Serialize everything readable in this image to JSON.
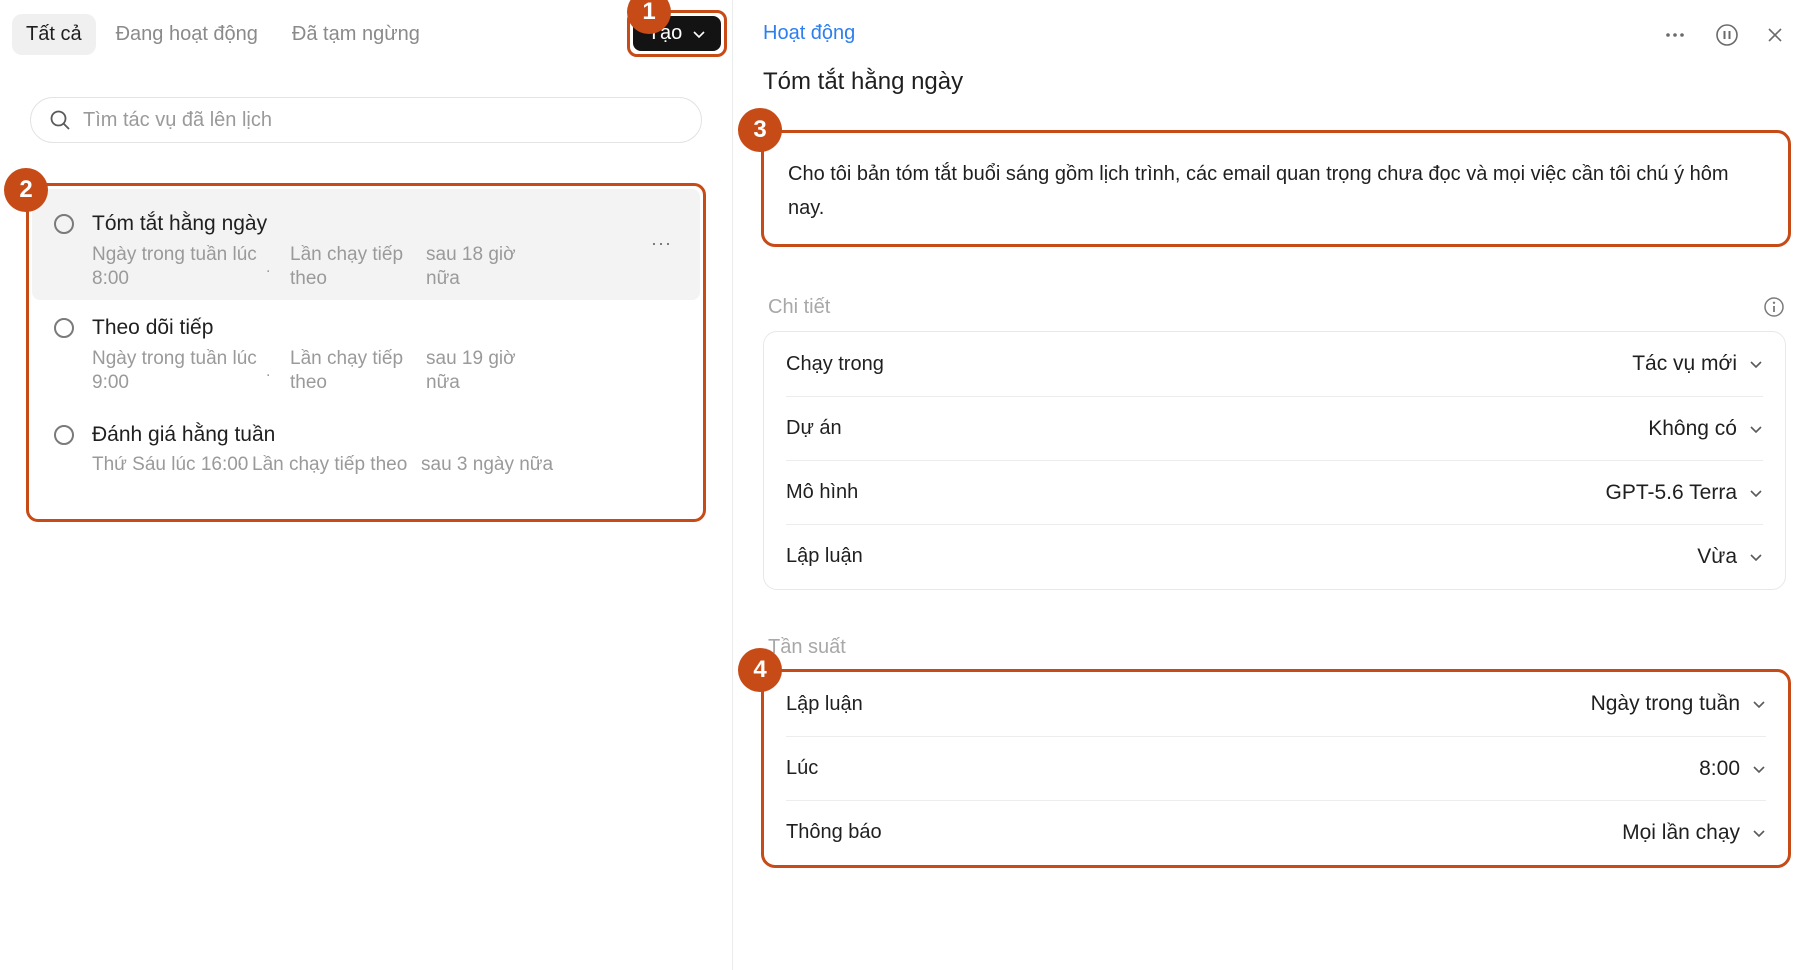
{
  "left": {
    "tabs": [
      "Tất cả",
      "Đang hoạt động",
      "Đã tạm ngừng"
    ],
    "create_label": "Tạo",
    "search_placeholder": "Tìm tác vụ đã lên lịch",
    "tasks": [
      {
        "title": "Tóm tắt hằng ngày",
        "schedule": "Ngày trong tuần lúc 8:00",
        "next_label": "Lần chạy tiếp theo",
        "next_value": "sau 18 giờ nữa",
        "highlighted": true
      },
      {
        "title": "Theo dõi tiếp",
        "schedule": "Ngày trong tuần lúc 9:00",
        "next_label": "Lần chạy tiếp theo",
        "next_value": "sau 19 giờ nữa"
      },
      {
        "title": "Đánh giá hằng tuần",
        "schedule": "Thứ Sáu lúc 16:00",
        "next_label": "Lần chạy tiếp theo",
        "next_value": "sau 3 ngày nữa"
      }
    ],
    "more_glyph": "···"
  },
  "badges": [
    "1",
    "2",
    "3",
    "4"
  ],
  "right": {
    "breadcrumb": "Hoạt động",
    "title": "Tóm tắt hằng ngày",
    "prompt": "Cho tôi bản tóm tắt buổi sáng gồm lịch trình, các email quan trọng chưa đọc và mọi việc cần tôi chú ý hôm nay.",
    "details_label": "Chi tiết",
    "details": [
      {
        "label": "Chạy trong",
        "value": "Tác vụ mới"
      },
      {
        "label": "Dự án",
        "value": "Không có"
      },
      {
        "label": "Mô hình",
        "value": "GPT-5.6 Terra"
      },
      {
        "label": "Lập luận",
        "value": "Vừa"
      }
    ],
    "frequency_label": "Tần suất",
    "frequency": [
      {
        "label": "Lập luận",
        "value": "Ngày trong tuần"
      },
      {
        "label": "Lúc",
        "value": "8:00"
      },
      {
        "label": "Thông báo",
        "value": "Mọi lần chạy"
      }
    ],
    "icons": [
      "more-icon",
      "pause-icon",
      "close-icon"
    ]
  },
  "colors": {
    "accent": "#c64b17",
    "link": "#2d7ff0",
    "dark_button": "#131313",
    "muted": "#9a9a9a"
  }
}
